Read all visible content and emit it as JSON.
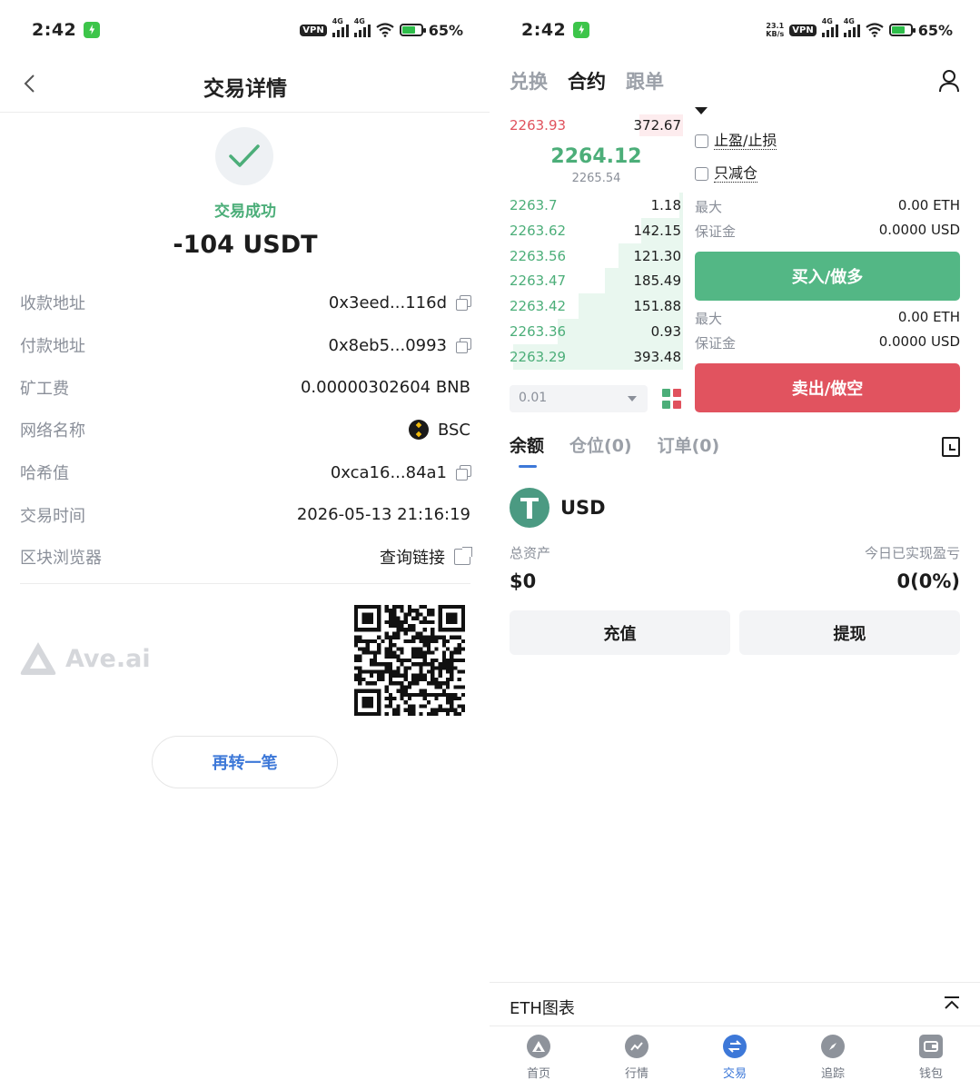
{
  "status_left": {
    "time": "2:42",
    "battery": "65%",
    "vpn": "VPN",
    "net": "4G"
  },
  "status_right": {
    "time": "2:42",
    "battery": "65%",
    "vpn": "VPN",
    "net": "4G",
    "speed_value": "23.1",
    "speed_unit": "KB/s"
  },
  "left": {
    "title": "交易详情",
    "status_text": "交易成功",
    "amount": "-104 USDT",
    "rows": [
      {
        "label": "收款地址",
        "value": "0x3eed...116d",
        "icon": "copy-icon"
      },
      {
        "label": "付款地址",
        "value": "0x8eb5...0993",
        "icon": "copy-icon"
      },
      {
        "label": "矿工费",
        "value": "0.00000302604 BNB"
      },
      {
        "label": "网络名称",
        "value": "BSC",
        "icon": "bsc-icon"
      },
      {
        "label": "哈希值",
        "value": "0xca16...84a1",
        "icon": "copy-icon"
      },
      {
        "label": "交易时间",
        "value": "2026-05-13 21:16:19"
      },
      {
        "label": "区块浏览器",
        "value": "查询链接",
        "icon": "external-link-icon"
      }
    ],
    "brand": "Ave.ai",
    "again_button": "再转一笔"
  },
  "right": {
    "tabs": [
      "兑换",
      "合约",
      "跟单"
    ],
    "active_tab": 1,
    "orderbook": {
      "ask": {
        "price": "2263.93",
        "qty": "372.67",
        "depth": 0.25
      },
      "last_price": "2264.12",
      "mark_price": "2265.54",
      "bids": [
        {
          "price": "2263.7",
          "qty": "1.18",
          "depth": 0.02
        },
        {
          "price": "2263.62",
          "qty": "142.15",
          "depth": 0.24
        },
        {
          "price": "2263.56",
          "qty": "121.30",
          "depth": 0.37
        },
        {
          "price": "2263.47",
          "qty": "185.49",
          "depth": 0.45
        },
        {
          "price": "2263.42",
          "qty": "151.88",
          "depth": 0.6
        },
        {
          "price": "2263.36",
          "qty": "0.93",
          "depth": 0.72
        },
        {
          "price": "2263.29",
          "qty": "393.48",
          "depth": 0.98
        }
      ],
      "depth_step": "0.01"
    },
    "options": {
      "tp_sl": "止盈/止损",
      "reduce_only": "只减仓"
    },
    "buy_info": {
      "max_label": "最大",
      "max_value": "0.00 ETH",
      "margin_label": "保证金",
      "margin_value": "0.0000  USD"
    },
    "buy_button": "买入/做多",
    "sell_info": {
      "max_label": "最大",
      "max_value": "0.00 ETH",
      "margin_label": "保证金",
      "margin_value": "0.0000  USD"
    },
    "sell_button": "卖出/做空",
    "sub_tabs": [
      "余额",
      "仓位(0)",
      "订单(0)"
    ],
    "asset": "USD",
    "total_assets_label": "总资产",
    "total_assets_value": "$0",
    "pnl_label": "今日已实现盈亏",
    "pnl_value": "0(0%)",
    "deposit_button": "充值",
    "withdraw_button": "提现",
    "chart_bar_label": "ETH图表",
    "nav": [
      {
        "label": "首页",
        "icon": "home-icon"
      },
      {
        "label": "行情",
        "icon": "market-icon"
      },
      {
        "label": "交易",
        "icon": "trade-icon"
      },
      {
        "label": "追踪",
        "icon": "compass-icon"
      },
      {
        "label": "钱包",
        "icon": "wallet-icon"
      }
    ],
    "active_nav": 2
  },
  "colors": {
    "green": "#4cae79",
    "red": "#e0525d",
    "blue": "#3d78d8",
    "buy": "#53b785",
    "sell": "#e1535f"
  }
}
